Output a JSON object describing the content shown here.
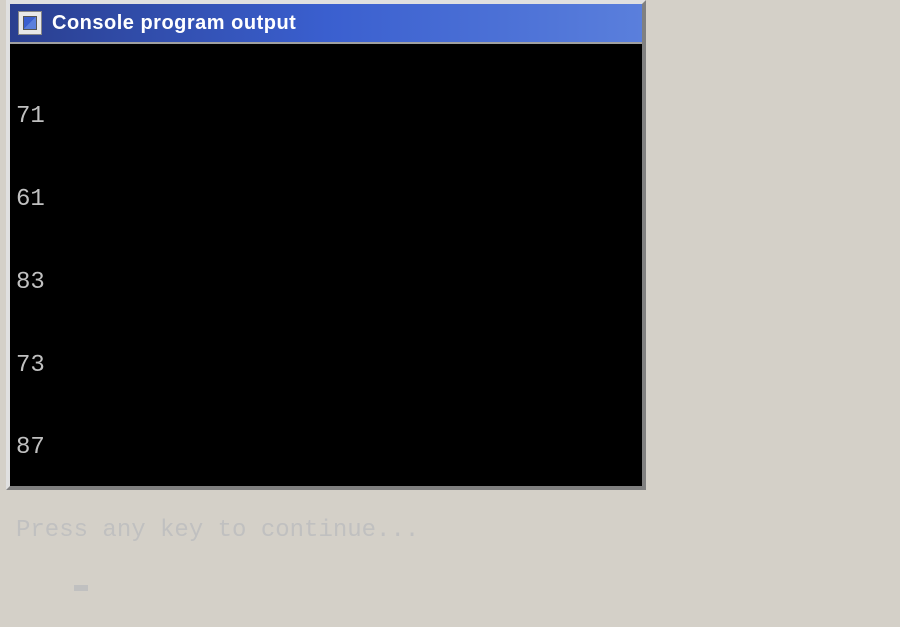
{
  "window": {
    "title": "Console program output"
  },
  "console": {
    "lines": [
      "71",
      "61",
      "83",
      "73",
      "87",
      "Press any key to continue..."
    ]
  }
}
